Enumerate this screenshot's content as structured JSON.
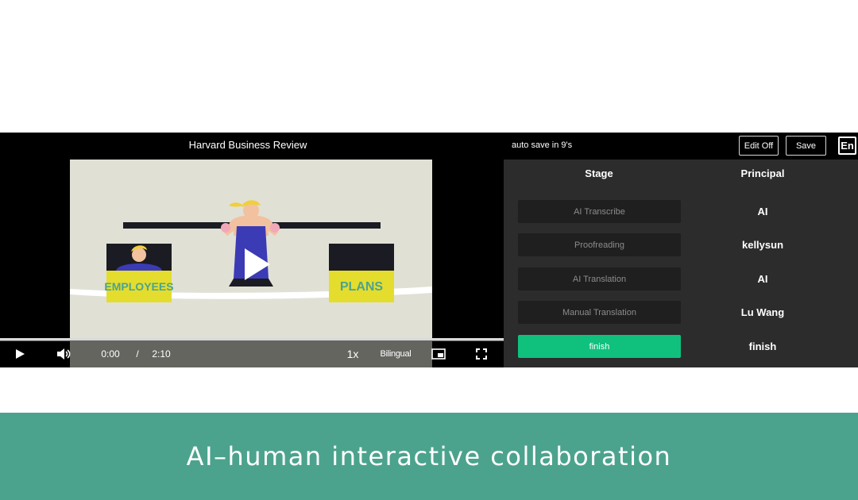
{
  "video": {
    "title": "Harvard Business Review",
    "scene": {
      "left_sign": "EMPLOYEES",
      "right_sign": "PLANS"
    },
    "controls": {
      "current_time": "0:00",
      "separator": "/",
      "duration": "2:10",
      "speed": "1x",
      "subtitle_mode": "Bilingual",
      "progress": 0
    }
  },
  "toolbar": {
    "autosave": "auto save in 9's",
    "edit_label": "Edit Off",
    "save_label": "Save",
    "language_label": "En"
  },
  "workflow": {
    "stage_header": "Stage",
    "principal_header": "Principal",
    "rows": [
      {
        "stage": "AI Transcribe",
        "principal": "AI",
        "active": false
      },
      {
        "stage": "Proofreading",
        "principal": "kellysun",
        "active": false
      },
      {
        "stage": "AI Translation",
        "principal": "AI",
        "active": false
      },
      {
        "stage": "Manual Translation",
        "principal": "Lu Wang",
        "active": false
      },
      {
        "stage": "finish",
        "principal": "finish",
        "active": true
      }
    ]
  },
  "banner": {
    "text": "AI–human interactive collaboration"
  },
  "colors": {
    "accent": "#10c17e",
    "banner": "#4ca38d",
    "panel": "#2c2c2c",
    "sign_yellow": "#e4dd2e",
    "overalls_blue": "#3b3bb5"
  }
}
